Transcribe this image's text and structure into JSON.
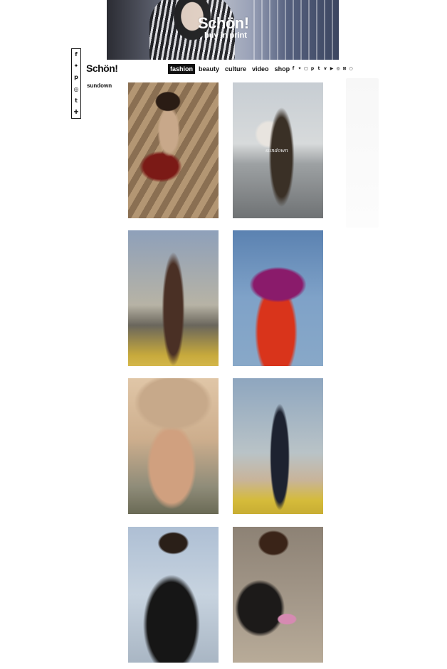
{
  "banner": {
    "title": "Schön!",
    "subtitle": "buy in print"
  },
  "share": {
    "icons": [
      {
        "name": "facebook-icon",
        "glyph": "f"
      },
      {
        "name": "twitter-icon",
        "glyph": "t"
      },
      {
        "name": "pinterest-icon",
        "glyph": "p"
      },
      {
        "name": "stumbleupon-icon",
        "glyph": "s"
      },
      {
        "name": "tumblr-icon",
        "glyph": "t"
      },
      {
        "name": "plus-icon",
        "glyph": "+"
      }
    ]
  },
  "header": {
    "logo": "Schön!",
    "nav": [
      "fashion",
      "beauty",
      "culture",
      "video",
      "shop"
    ],
    "active_nav": "fashion"
  },
  "section": {
    "title": "sundown"
  },
  "photos": {
    "p2_caption": "sundown"
  },
  "colors": {
    "accent": "#111111",
    "background": "#ffffff"
  }
}
